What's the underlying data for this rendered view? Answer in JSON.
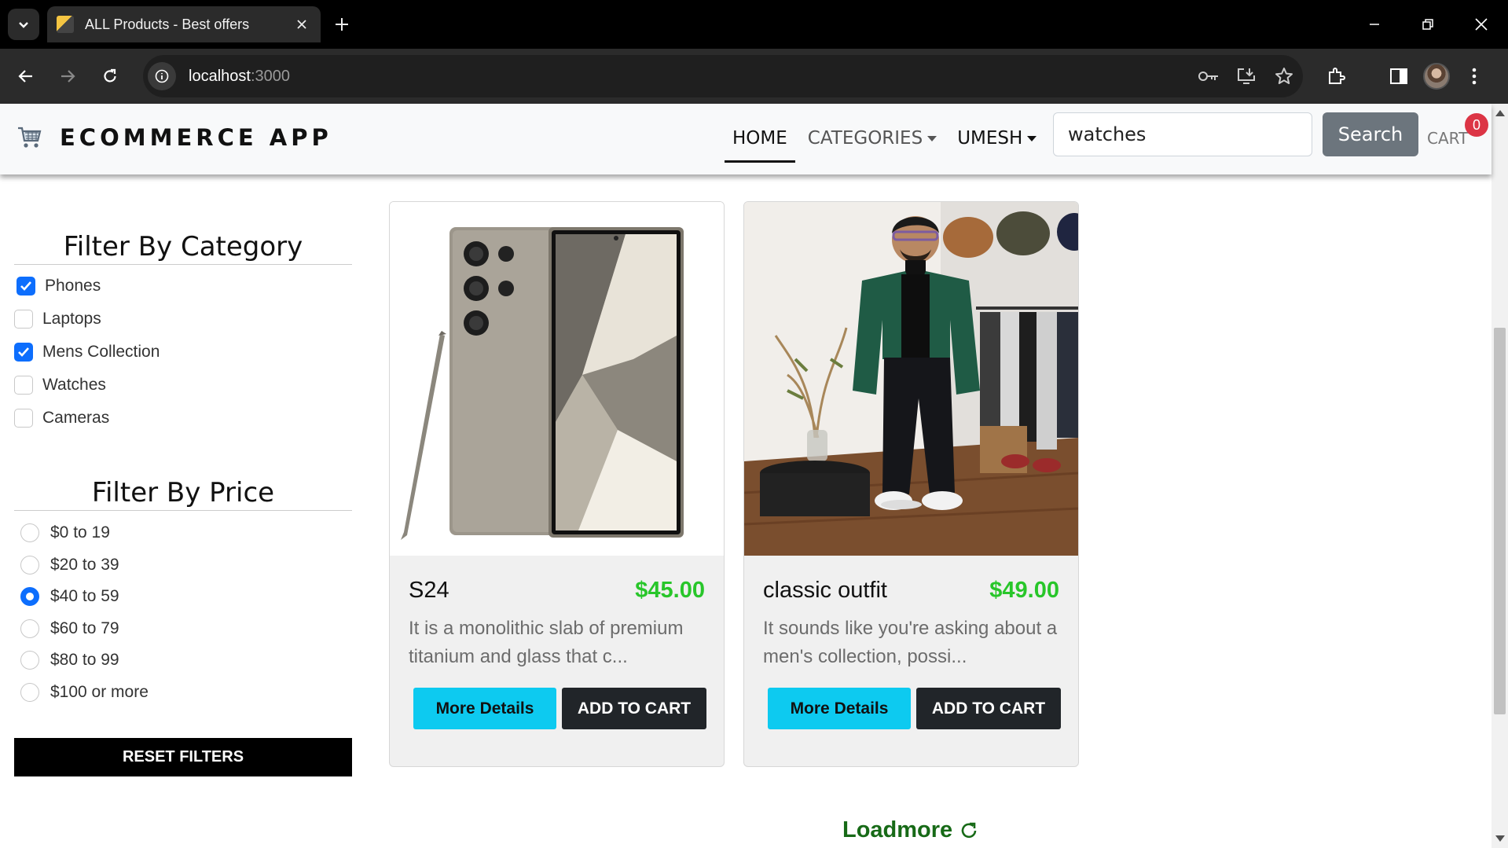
{
  "browser": {
    "tab_title": "ALL Products - Best offers",
    "url_host": "localhost",
    "url_port": ":3000"
  },
  "app": {
    "brand": "ECOMMERCE APP",
    "nav": {
      "home": "HOME",
      "categories": "CATEGORIES",
      "user": "UMESH",
      "cart": "CART",
      "cart_count": "0"
    },
    "search": {
      "value": "watches",
      "button": "Search"
    }
  },
  "filters": {
    "category_heading": "Filter By Category",
    "categories": [
      {
        "label": "Phones",
        "checked": true
      },
      {
        "label": "Laptops",
        "checked": false
      },
      {
        "label": "Mens Collection",
        "checked": true
      },
      {
        "label": "Watches",
        "checked": false
      },
      {
        "label": "Cameras",
        "checked": false
      }
    ],
    "price_heading": "Filter By Price",
    "prices": [
      {
        "label": "$0 to 19",
        "checked": false
      },
      {
        "label": "$20 to 39",
        "checked": false
      },
      {
        "label": "$40 to 59",
        "checked": true
      },
      {
        "label": "$60 to 79",
        "checked": false
      },
      {
        "label": "$80 to 99",
        "checked": false
      },
      {
        "label": "$100 or more",
        "checked": false
      }
    ],
    "reset": "RESET FILTERS"
  },
  "products": [
    {
      "name": "S24",
      "price": "$45.00",
      "description": "It is a monolithic slab of premium titanium and glass that c...",
      "details_label": "More Details",
      "cart_label": "ADD TO CART"
    },
    {
      "name": "classic outfit",
      "price": "$49.00",
      "description": "It sounds like you're asking about a men's collection, possi...",
      "details_label": "More Details",
      "cart_label": "ADD TO CART"
    }
  ],
  "loadmore": "Loadmore",
  "colors": {
    "price": "#28c62a",
    "accent": "#0d6efd",
    "details_button": "#0dcaf0",
    "badge": "#dc3545"
  }
}
